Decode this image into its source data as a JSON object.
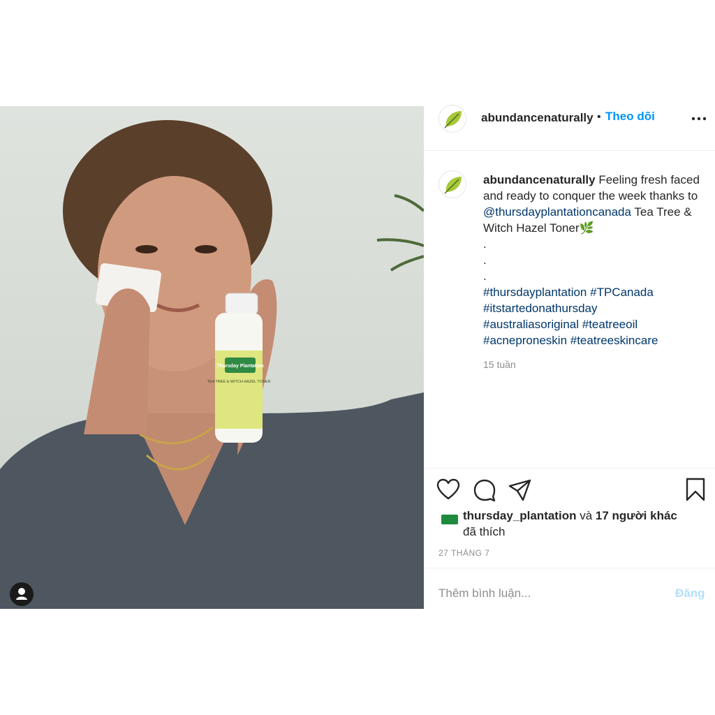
{
  "post": {
    "username": "abundancenaturally",
    "separator": "•",
    "follow_label": "Theo dõi",
    "more_icon": "more-dots-icon",
    "avatar_icon": "leaf-logo-icon",
    "caption": {
      "username": "abundancenaturally",
      "text_before_mention": " Feeling fresh faced and ready to conquer the week thanks to ",
      "mention": "@thursdayplantationcanada",
      "text_after_mention": " Tea Tree & Witch Hazel Toner🌿",
      "dots": [
        ".",
        ".",
        "."
      ],
      "hashtags_line1": "#thursdayplantation #TPCanada",
      "hashtags_line2": "#itstartedonathursday",
      "hashtags_line3": "#australiasoriginal #teatreeoil",
      "hashtags_line4": "#acneproneskin #teatreeskincare"
    },
    "time_ago": "15 tuần",
    "likes": {
      "liker": "thursday_plantation",
      "connector": " và ",
      "others": "17 người khác",
      "suffix": "đã thích"
    },
    "date": "27 THÁNG 7",
    "comment_placeholder": "Thêm bình luận...",
    "post_button": "Đăng"
  },
  "photo": {
    "bottle_brand": "Thursday Plantation",
    "bottle_line": "TEA TREE & WITCH HAZEL TONER"
  },
  "colors": {
    "link": "#00376b",
    "follow": "#0095f6",
    "post_disabled": "#b2dffc",
    "muted": "#8e8e8e"
  }
}
